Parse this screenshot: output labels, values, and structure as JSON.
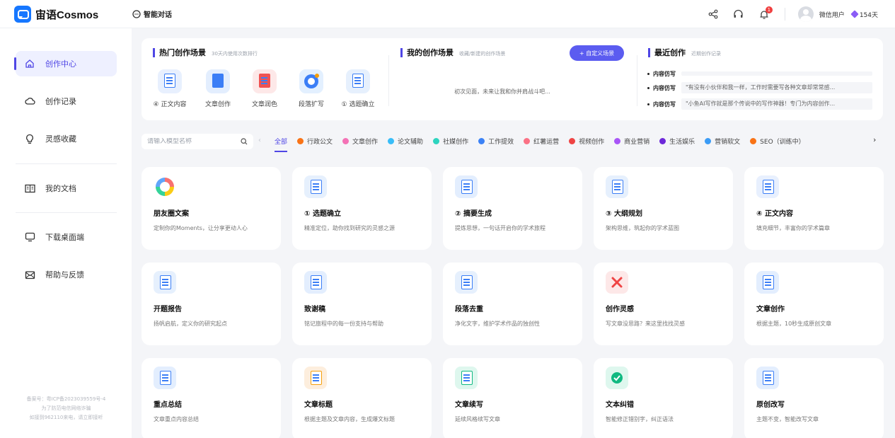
{
  "header": {
    "brand": "宙语Cosmos",
    "chat_tab": "智能对话",
    "username": "微信用户",
    "vip_days": "154天",
    "notification_count": "1"
  },
  "sidebar": {
    "items": [
      {
        "label": "创作中心",
        "icon": "home-icon",
        "active": true
      },
      {
        "label": "创作记录",
        "icon": "cloud-icon"
      },
      {
        "label": "灵感收藏",
        "icon": "lightbulb-icon"
      },
      {
        "label": "我的文档",
        "icon": "book-icon"
      },
      {
        "label": "下载桌面端",
        "icon": "monitor-icon"
      },
      {
        "label": "帮助与反馈",
        "icon": "mail-icon"
      }
    ],
    "footer": [
      "备案号：粤ICP备2023039559号-4",
      "为了防范电信网络诈骗",
      "如接到962110来电，请立即接听"
    ]
  },
  "hot": {
    "title": "热门创作场景",
    "subtitle": "30天内使用次数排行",
    "items": [
      {
        "label": "④ 正文内容",
        "color": "#e8f0fe"
      },
      {
        "label": "文章创作",
        "color": "#e3eefe"
      },
      {
        "label": "文章润色",
        "color": "#fde8e8"
      },
      {
        "label": "段落扩写",
        "color": "#e3f0ff"
      },
      {
        "label": "① 选题确立",
        "color": "#e6f0fd"
      }
    ]
  },
  "mine": {
    "title": "我的创作场景",
    "subtitle": "收藏/新建的创作场景",
    "custom_button": "+ 自定义场景",
    "empty": "初次见面，未来让我和你并肩战斗吧..."
  },
  "recent": {
    "title": "最近创作",
    "subtitle": "近期创作记录",
    "items": [
      {
        "label": "内容仿写",
        "text": ""
      },
      {
        "label": "内容仿写",
        "text": "\"有没有小伙伴和我一样，工作时需要写各种文章却常常感..."
      },
      {
        "label": "内容仿写",
        "text": "\"小鱼AI写作就是那个传说中的写作神器！专门为内容创作..."
      }
    ]
  },
  "filter": {
    "search_placeholder": "请输入模型名称",
    "categories": [
      {
        "label": "全部",
        "color": "",
        "active": true
      },
      {
        "label": "行政公文",
        "color": "#f97316"
      },
      {
        "label": "文章创作",
        "color": "#f472b6"
      },
      {
        "label": "论文辅助",
        "color": "#38bdf8"
      },
      {
        "label": "社媒创作",
        "color": "#2dd4bf"
      },
      {
        "label": "工作提效",
        "color": "#3b82f6"
      },
      {
        "label": "红薯运营",
        "color": "#fb7185"
      },
      {
        "label": "视频创作",
        "color": "#ef4444"
      },
      {
        "label": "商业营销",
        "color": "#a855f7"
      },
      {
        "label": "生活娱乐",
        "color": "#6d28d9"
      },
      {
        "label": "营销软文",
        "color": "#3b9cf6"
      },
      {
        "label": "SEO（训练中）",
        "color": "#f97316"
      }
    ]
  },
  "cards": [
    {
      "title": "朋友圈文案",
      "desc": "定制你的Moments，让分享更动人心",
      "icon": "ring",
      "bg": "#ffffff"
    },
    {
      "title": "① 选题确立",
      "desc": "精准定位，助你找到研究的灵感之源",
      "icon": "doc",
      "bg": "#e6f0fd"
    },
    {
      "title": "② 摘要生成",
      "desc": "提炼思想，一句话开启你的学术旅程",
      "icon": "doc",
      "bg": "#e3eefe"
    },
    {
      "title": "③ 大纲规划",
      "desc": "架构思维，筑起你的学术蓝图",
      "icon": "doc",
      "bg": "#e6f0fd"
    },
    {
      "title": "④ 正文内容",
      "desc": "填充细节，丰富你的学术篇章",
      "icon": "doc",
      "bg": "#e8f0fe"
    },
    {
      "title": "开题报告",
      "desc": "扬帆启航，定义你的研究起点",
      "icon": "doc",
      "bg": "#e6f0fd"
    },
    {
      "title": "致谢稿",
      "desc": "铭记旅程中的每一份支持与帮助",
      "icon": "doc",
      "bg": "#e3eefe"
    },
    {
      "title": "段落去重",
      "desc": "净化文字，维护学术作品的独创性",
      "icon": "doc",
      "bg": "#e6f0fd"
    },
    {
      "title": "创作灵感",
      "desc": "写文章没思路？来这里找找灵感",
      "icon": "cross",
      "bg": "#fde8e8"
    },
    {
      "title": "文章创作",
      "desc": "根据主题，10秒生成原创文章",
      "icon": "doc",
      "bg": "#e3eefe"
    },
    {
      "title": "重点总结",
      "desc": "文章重点内容总结",
      "icon": "doc",
      "bg": "#e3eefe"
    },
    {
      "title": "文章标题",
      "desc": "根据主题及文章内容，生成爆文标题",
      "icon": "doc-orange",
      "bg": "#fdeedd"
    },
    {
      "title": "文章续写",
      "desc": "延续风格续写文章",
      "icon": "doc-green",
      "bg": "#def7ee"
    },
    {
      "title": "文本纠错",
      "desc": "智能修正错别字，纠正语法",
      "icon": "check",
      "bg": "#def7ee"
    },
    {
      "title": "原创改写",
      "desc": "主题不变，智能改写文章",
      "icon": "doc",
      "bg": "#e3eefe"
    }
  ]
}
